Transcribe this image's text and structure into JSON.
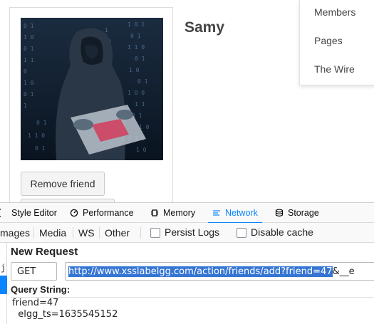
{
  "profile": {
    "name": "Samy",
    "remove_friend_label": "Remove friend"
  },
  "dropdown_menu": {
    "items": [
      {
        "label": "Members"
      },
      {
        "label": "Pages"
      },
      {
        "label": "The Wire"
      }
    ]
  },
  "devtools": {
    "tabs": [
      {
        "label": "Style Editor",
        "icon": "style-editor-icon"
      },
      {
        "label": "Performance",
        "icon": "performance-icon"
      },
      {
        "label": "Memory",
        "icon": "memory-icon"
      },
      {
        "label": "Network",
        "icon": "network-icon",
        "active": true
      },
      {
        "label": "Storage",
        "icon": "storage-icon"
      }
    ],
    "filter_types": [
      "mages",
      "Media",
      "WS",
      "Other"
    ],
    "persist_logs_label": "Persist Logs",
    "disable_cache_label": "Disable cache",
    "sidebar_letter": "j",
    "new_request": {
      "title": "New Request",
      "method": "GET",
      "url_selected": "http://www.xsslabelgg.com/action/friends/add?friend=47",
      "url_rest": "&__e",
      "query_string_title": "Query String:",
      "query_lines": [
        "friend=47",
        "  elgg_ts=1635545152"
      ]
    }
  },
  "colors": {
    "accent": "#0a84ff",
    "url_selection": "#3575d3"
  }
}
